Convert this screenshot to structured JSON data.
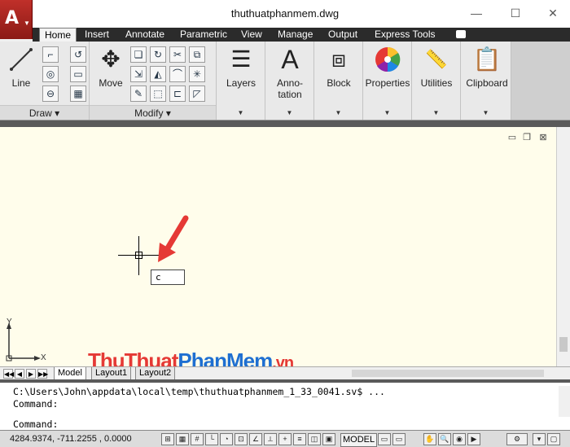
{
  "window": {
    "title": "thuthuatphanmem.dwg",
    "minimize": "—",
    "maximize": "☐",
    "close": "✕"
  },
  "app_button": {
    "logo": "A",
    "caret": "▼"
  },
  "tabs": [
    {
      "label": "Home"
    },
    {
      "label": "Insert"
    },
    {
      "label": "Annotate"
    },
    {
      "label": "Parametric"
    },
    {
      "label": "View"
    },
    {
      "label": "Manage"
    },
    {
      "label": "Output"
    },
    {
      "label": "Express Tools"
    }
  ],
  "ribbon": {
    "draw": {
      "title": "Draw ▾",
      "line_label": "Line"
    },
    "modify": {
      "title": "Modify ▾",
      "move_label": "Move"
    },
    "layers": {
      "label": "Layers"
    },
    "annotation": {
      "label_top": "Anno-",
      "label_bottom": "tation"
    },
    "block": {
      "label": "Block"
    },
    "properties": {
      "label": "Properties"
    },
    "utilities": {
      "label": "Utilities"
    },
    "clipboard": {
      "label": "Clipboard"
    },
    "dropdown": "▼"
  },
  "canvas": {
    "tooltip_value": "c",
    "ucs_x": "X",
    "ucs_y": "Y",
    "viewport_min": "▭",
    "viewport_restore": "❐",
    "viewport_close": "⊠"
  },
  "watermark": {
    "part1": "ThuThuat",
    "part2": "PhanMem",
    "part3": ".vn"
  },
  "layout_tabs": [
    {
      "label": "Model"
    },
    {
      "label": "Layout1"
    },
    {
      "label": "Layout2"
    }
  ],
  "nav": [
    "◀◀",
    "◀",
    "▶",
    "▶▶"
  ],
  "command": {
    "history1": "C:\\Users\\John\\appdata\\local\\temp\\thuthuatphanmem_1_33_0041.sv$ ...",
    "history2": "Command:",
    "prompt": "Command:"
  },
  "status": {
    "coords": "4284.9374, -711.2255 , 0.0000",
    "model": "MODEL"
  }
}
